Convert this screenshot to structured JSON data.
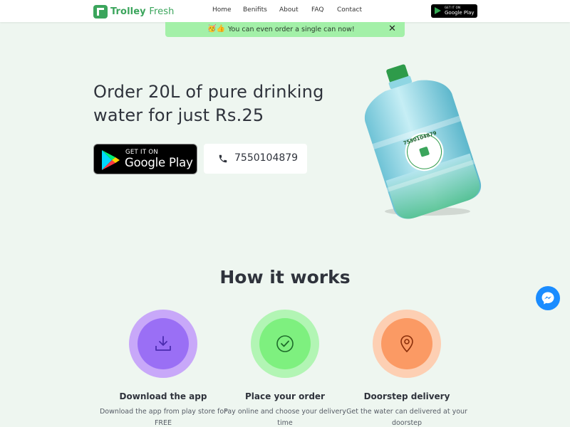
{
  "header": {
    "logo": {
      "brand_main": "Trolley",
      "brand_sub": "Fresh"
    },
    "nav": [
      "Home",
      "Benifits",
      "About",
      "FAQ",
      "Contact"
    ],
    "play_badge": {
      "small": "GET IT ON",
      "big": "Google Play"
    }
  },
  "banner": {
    "emoji": "🥳👍",
    "text": "You can even order a single can now!",
    "close": "✕"
  },
  "hero": {
    "headline_line1": "Order 20L of pure drinking",
    "headline_line2": "water for just Rs.25",
    "play_button": {
      "small": "GET IT ON",
      "big": "Google Play"
    },
    "phone": "7550104879",
    "bottle_label": "7550104879"
  },
  "how_it_works": {
    "title": "How it works",
    "steps": [
      {
        "title": "Download the app",
        "desc": "Download the app from play store for FREE",
        "icon": "download-icon",
        "color": "#9a6ff5"
      },
      {
        "title": "Place your order",
        "desc": "Pay online and choose your delivery time",
        "icon": "check-circle-icon",
        "color": "#7ef07f"
      },
      {
        "title": "Doorstep delivery",
        "desc": "Get the water can delivered at your doorstep",
        "icon": "location-pin-icon",
        "color": "#fb9a64"
      }
    ]
  },
  "colors": {
    "brand_green": "#3ba55c",
    "banner_bg": "#a3f0a8",
    "page_bg": "#eef6f0",
    "messenger_blue": "#1a8cff"
  }
}
